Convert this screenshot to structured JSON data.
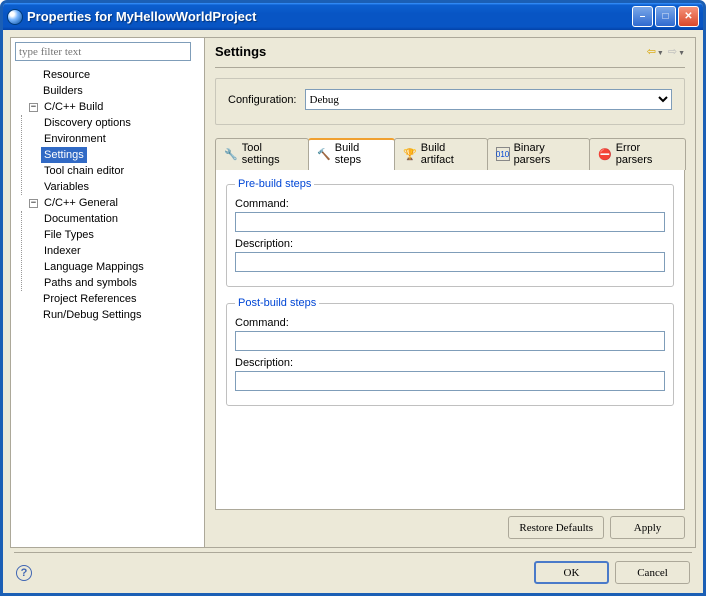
{
  "window": {
    "title": "Properties for MyHellowWorldProject"
  },
  "filter": {
    "placeholder": "type filter text"
  },
  "tree": {
    "resource": "Resource",
    "builders": "Builders",
    "ccbuild": "C/C++ Build",
    "discovery": "Discovery options",
    "environment": "Environment",
    "settings": "Settings",
    "toolchain": "Tool chain editor",
    "variables": "Variables",
    "ccgeneral": "C/C++ General",
    "documentation": "Documentation",
    "filetypes": "File Types",
    "indexer": "Indexer",
    "langmap": "Language Mappings",
    "paths": "Paths and symbols",
    "projrefs": "Project References",
    "rundebug": "Run/Debug Settings"
  },
  "page": {
    "title": "Settings",
    "config_label": "Configuration:",
    "config_value": "Debug"
  },
  "tabs": {
    "tool": "Tool settings",
    "steps": "Build steps",
    "artifact": "Build artifact",
    "binary": "Binary parsers",
    "error": "Error parsers"
  },
  "steps": {
    "pre_legend": "Pre-build steps",
    "post_legend": "Post-build steps",
    "command": "Command:",
    "description": "Description:",
    "pre_cmd": "",
    "pre_desc": "",
    "post_cmd": "",
    "post_desc": ""
  },
  "buttons": {
    "restore": "Restore Defaults",
    "apply": "Apply",
    "ok": "OK",
    "cancel": "Cancel"
  }
}
